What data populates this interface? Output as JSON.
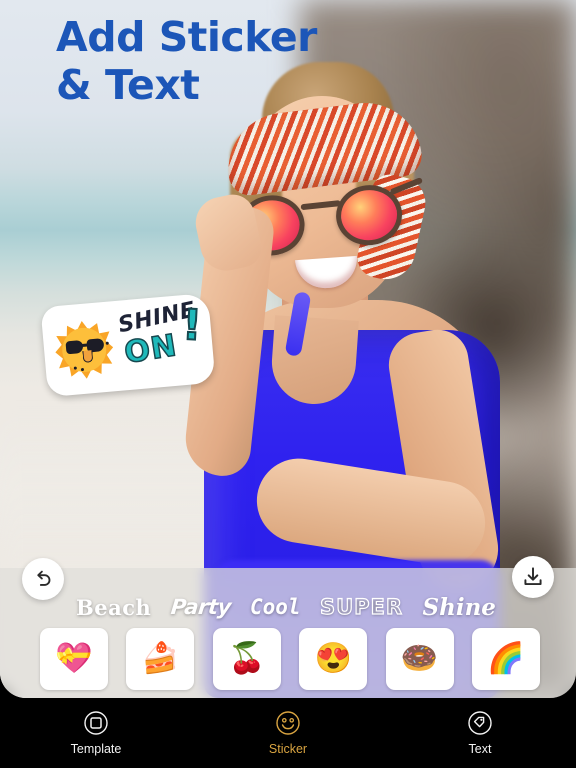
{
  "heading": {
    "text": "Add Sticker\n& Text",
    "color": "#1c56b8"
  },
  "photo": {
    "subject": "woman-wearing-sunglasses-and-headband-at-beach",
    "dress_color": "#2f22ef",
    "headband_color": "#e2542c",
    "lens_color": "#f8425f"
  },
  "overlay_sticker": {
    "name": "shine-on-sun-sticker",
    "word_1": "SHINE",
    "word_2": "ON",
    "punctuation": "!",
    "sun_color": "#fdbf3b",
    "word_1_color": "#1e2336",
    "word_2_color": "#1fb9ba"
  },
  "toolbar": {
    "undo_label": "undo",
    "undo_icon": "undo-arrow-icon",
    "save_label": "save",
    "save_icon": "download-icon"
  },
  "text_styles": [
    {
      "label": "Beach",
      "style": "serif-bold"
    },
    {
      "label": "Party",
      "style": "rounded-handwriting"
    },
    {
      "label": "Cool",
      "style": "mono-italic"
    },
    {
      "label": "SUPER",
      "style": "outlined-comic"
    },
    {
      "label": "Shine",
      "style": "script-italic"
    }
  ],
  "stickers": [
    {
      "name": "heart-with-ribbon-sticker",
      "glyph": "💝"
    },
    {
      "name": "cake-slice-sticker",
      "glyph": "🍰"
    },
    {
      "name": "cherries-sticker",
      "glyph": "🍒"
    },
    {
      "name": "smiling-face-with-hearts-sticker",
      "glyph": "😍"
    },
    {
      "name": "doughnut-sticker",
      "glyph": "🍩"
    },
    {
      "name": "rainbow-sticker",
      "glyph": "🌈"
    }
  ],
  "nav": {
    "active": "Sticker",
    "active_color": "#d9a441",
    "items": [
      {
        "label": "Template",
        "icon": "square-frame-icon"
      },
      {
        "label": "Sticker",
        "icon": "smiley-face-icon"
      },
      {
        "label": "Text",
        "icon": "tag-label-icon"
      }
    ]
  }
}
